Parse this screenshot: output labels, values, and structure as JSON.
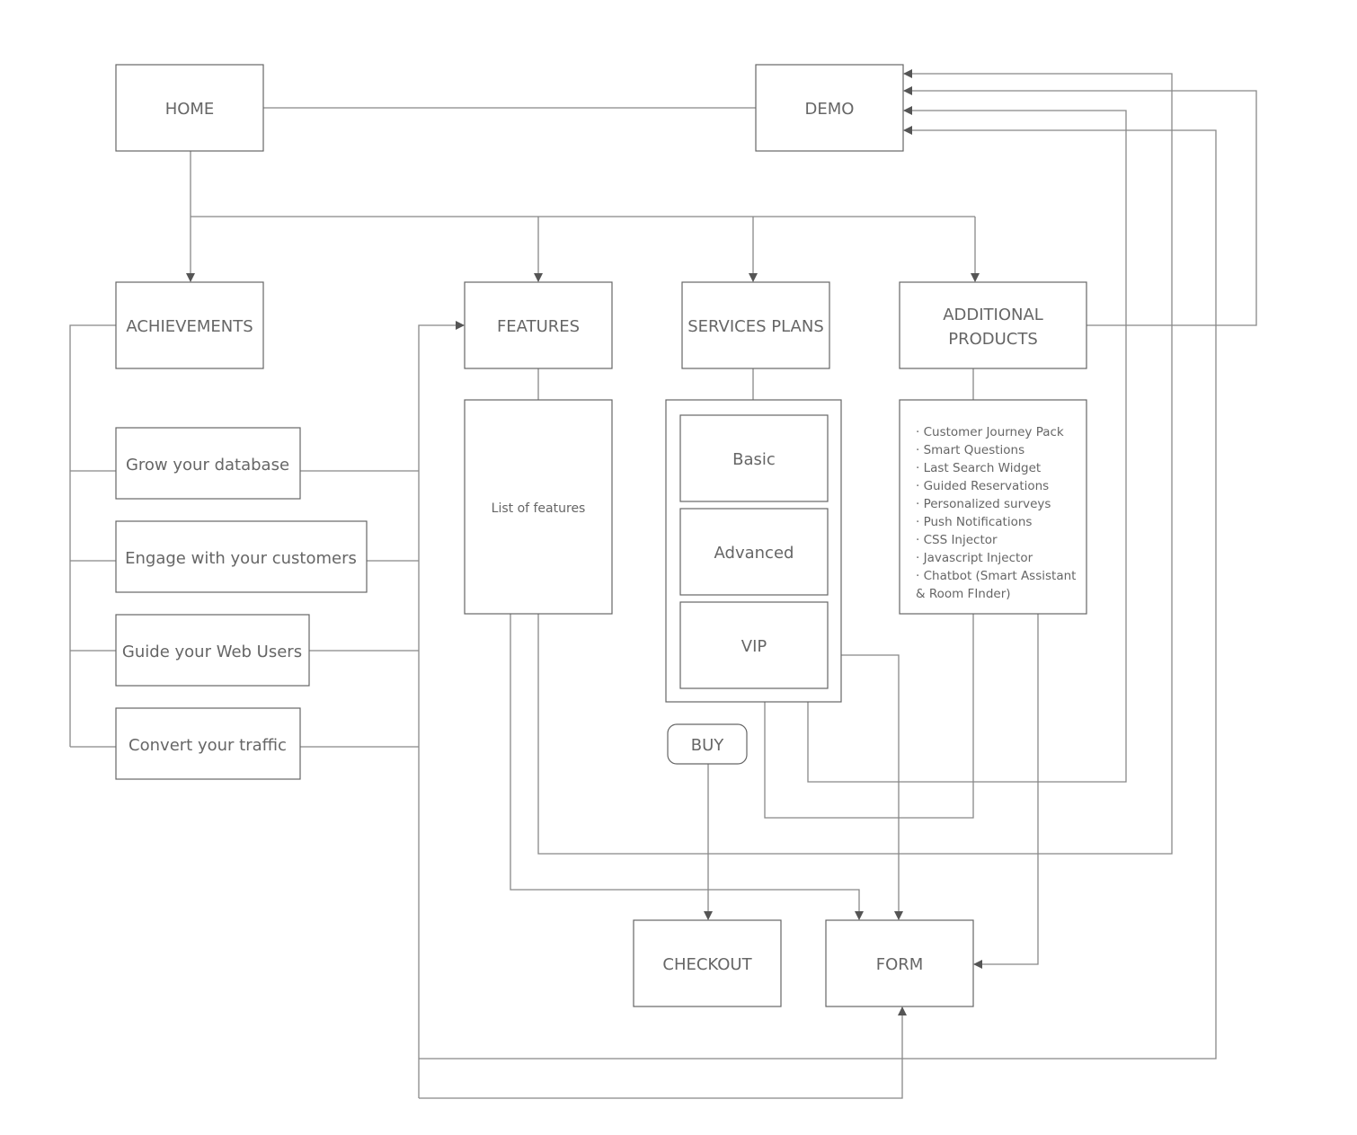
{
  "nodes": {
    "home": "HOME",
    "demo": "DEMO",
    "achievements": "ACHIEVEMENTS",
    "features": "FEATURES",
    "services_plans": "SERVICES PLANS",
    "additional_products_line1": "ADDITIONAL",
    "additional_products_line2": "PRODUCTS",
    "grow": "Grow your database",
    "engage": "Engage with your customers",
    "guide": "Guide your Web Users",
    "convert": "Convert your traffic",
    "list_of_features": "List of features",
    "basic": "Basic",
    "advanced": "Advanced",
    "vip": "VIP",
    "buy": "BUY",
    "checkout": "CHECKOUT",
    "form": "FORM"
  },
  "additional_products_list": [
    "· Customer Journey Pack",
    "· Smart Questions",
    "· Last Search Widget",
    "· Guided Reservations",
    "· Personalized surveys",
    "· Push Notifications",
    "· CSS Injector",
    "· Javascript Injector",
    "· Chatbot (Smart Assistant",
    "& Room FInder)"
  ],
  "colors": {
    "stroke": "#666666",
    "line": "#888888",
    "text": "#666666"
  }
}
